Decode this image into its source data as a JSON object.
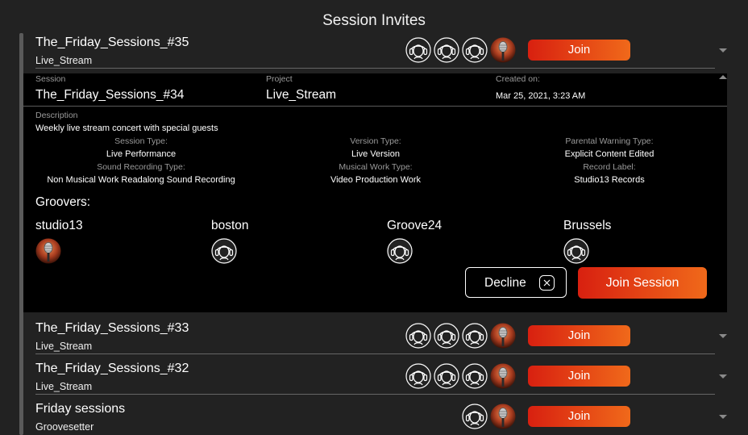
{
  "page_title": "Session Invites",
  "rows": [
    {
      "name": "The_Friday_Sessions_#35",
      "sub": "Live_Stream",
      "join_label": "Join",
      "avatars": [
        "headphones-avatar-icon",
        "headphones-avatar-icon",
        "headphones-avatar-icon",
        "microphone-photo-avatar"
      ]
    },
    {
      "name": "The_Friday_Sessions_#33",
      "sub": "Live_Stream",
      "join_label": "Join",
      "avatars": [
        "headphones-avatar-icon",
        "headphones-avatar-icon",
        "headphones-avatar-icon",
        "microphone-photo-avatar"
      ]
    },
    {
      "name": "The_Friday_Sessions_#32",
      "sub": "Live_Stream",
      "join_label": "Join",
      "avatars": [
        "headphones-avatar-icon",
        "headphones-avatar-icon",
        "headphones-avatar-icon",
        "microphone-photo-avatar"
      ]
    },
    {
      "name": "Friday sessions",
      "sub": "Groovesetter",
      "join_label": "Join",
      "avatars": [
        "headphones-avatar-icon",
        "microphone-photo-avatar"
      ]
    }
  ],
  "detail": {
    "session_label": "Session",
    "session_value": "The_Friday_Sessions_#34",
    "project_label": "Project",
    "project_value": "Live_Stream",
    "created_label": "Created on:",
    "created_value": "Mar 25, 2021, 3:23 AM",
    "description_label": "Description",
    "description_value": "Weekly live stream concert with special guests",
    "fields": [
      {
        "label": "Session Type:",
        "value": "Live Performance"
      },
      {
        "label": "Version Type:",
        "value": "Live Version"
      },
      {
        "label": "Parental Warning Type:",
        "value": "Explicit Content Edited"
      },
      {
        "label": "Sound Recording Type:",
        "value": "Non Musical Work Readalong Sound Recording"
      },
      {
        "label": "Musical Work Type:",
        "value": "Video Production Work"
      },
      {
        "label": "Record Label:",
        "value": "Studio13 Records"
      }
    ],
    "groovers_label": "Groovers:",
    "groovers": [
      {
        "name": "studio13",
        "avatar": "microphone-photo-avatar"
      },
      {
        "name": "boston",
        "avatar": "headphones-avatar-icon"
      },
      {
        "name": "Groove24",
        "avatar": "headphones-avatar-icon"
      },
      {
        "name": "Brussels",
        "avatar": "headphones-avatar-icon"
      }
    ],
    "decline_label": "Decline",
    "join_session_label": "Join Session"
  },
  "colors": {
    "background": "#222222",
    "detail_bg": "#000000",
    "accent_start": "#d82010",
    "accent_end": "#f0691a"
  }
}
